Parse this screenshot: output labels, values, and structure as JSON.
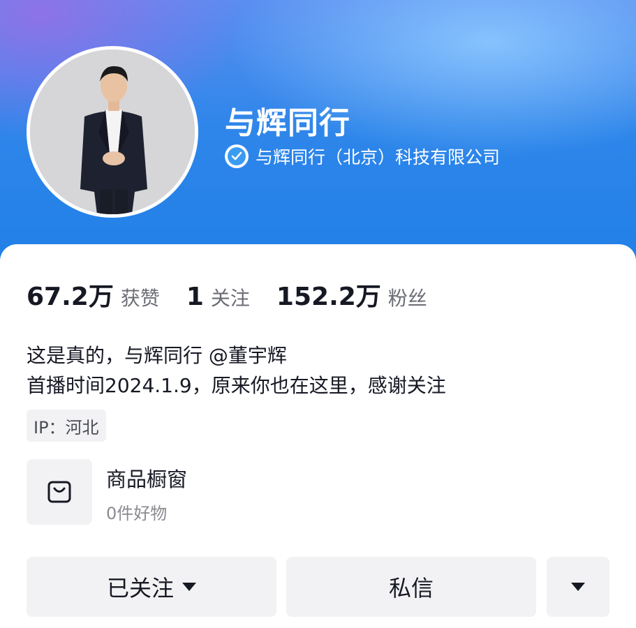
{
  "profile": {
    "name": "与辉同行",
    "verification": "与辉同行（北京）科技有限公司"
  },
  "stats": [
    {
      "value": "67.2万",
      "label": "获赞"
    },
    {
      "value": "1",
      "label": "关注"
    },
    {
      "value": "152.2万",
      "label": "粉丝"
    }
  ],
  "bio": {
    "line1": "这是真的，与辉同行 @董宇辉",
    "line2": "首播时间2024.1.9，原来你也在这里，感谢关注"
  },
  "ip": "IP：河北",
  "shop": {
    "title": "商品橱窗",
    "subtitle": "0件好物",
    "icon": "shopping-bag-icon"
  },
  "actions": {
    "follow_label": "已关注",
    "message_label": "私信"
  },
  "colors": {
    "header_blue": "#1f7fe6",
    "verify_blue": "#3a9bf2",
    "button_bg": "#f2f2f4"
  }
}
